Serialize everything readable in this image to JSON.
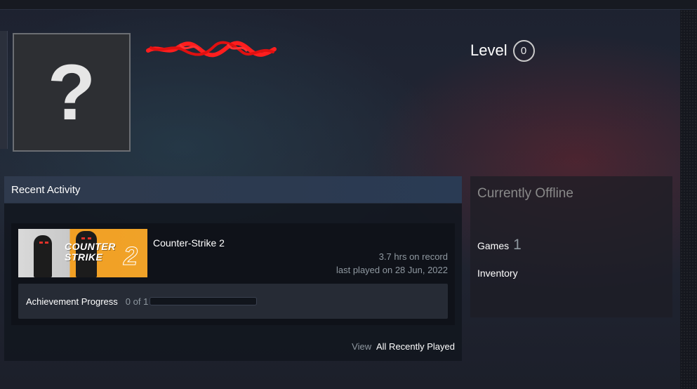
{
  "profile": {
    "avatar_glyph": "?",
    "level_label": "Level",
    "level_value": "0"
  },
  "activity": {
    "header": "Recent Activity",
    "game": {
      "capsule_title": "COUNTER STRIKE",
      "capsule_number": "2",
      "name": "Counter-Strike 2",
      "hours": "3.7 hrs on record",
      "last_played": "last played on 28 Jun, 2022",
      "achievement_label": "Achievement Progress",
      "achievement_count": "0 of 1",
      "achievement_progress": 0
    },
    "view_label": "View",
    "view_link": "All Recently Played"
  },
  "status": {
    "title": "Currently Offline",
    "games_label": "Games",
    "games_count": "1",
    "inventory_label": "Inventory"
  },
  "colors": {
    "scribble": "#ff1e1e",
    "accent_orange": "#f0a228",
    "page_bg": "#1b1f2a"
  },
  "icons": {
    "avatar": "question-mark-avatar-icon"
  }
}
